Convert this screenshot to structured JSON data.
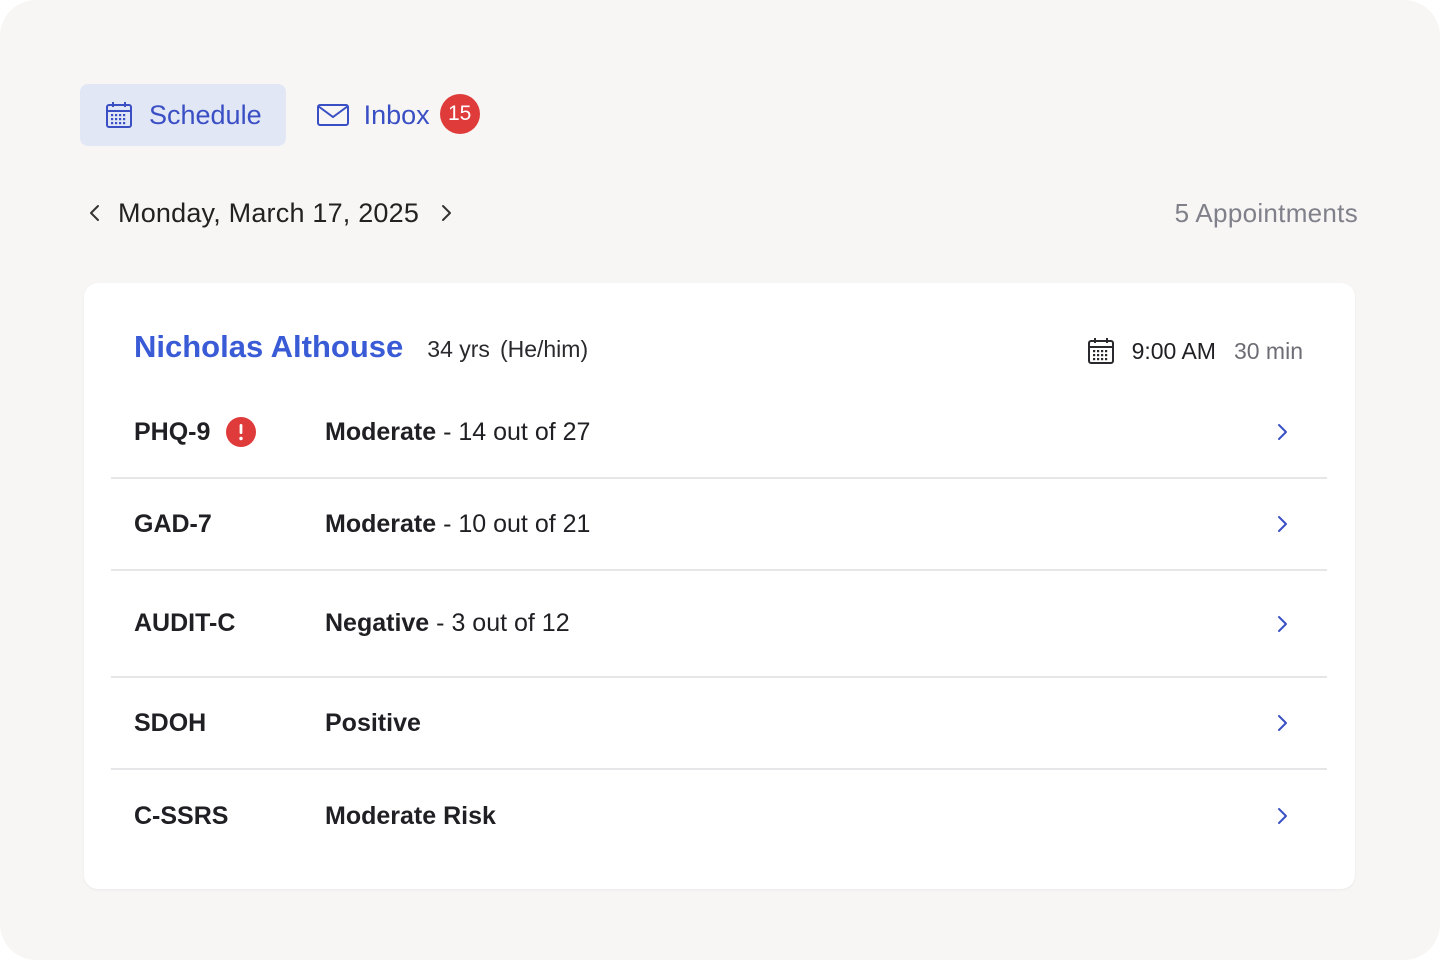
{
  "tabs": {
    "schedule_label": "Schedule",
    "inbox_label": "Inbox",
    "inbox_badge": "15"
  },
  "date_nav": {
    "date": "Monday, March 17, 2025",
    "appointment_count": "5 Appointments"
  },
  "appointment": {
    "patient_name": "Nicholas Althouse",
    "age": "34 yrs",
    "pronouns": "(He/him)",
    "time": "9:00 AM",
    "duration": "30 min"
  },
  "screenings": [
    {
      "measure": "PHQ-9",
      "level": "Moderate",
      "detail": "- 14 out of 27",
      "alert": true
    },
    {
      "measure": "GAD-7",
      "level": "Moderate",
      "detail": "- 10 out of 21",
      "alert": false
    },
    {
      "measure": "AUDIT-C",
      "level": "Negative",
      "detail": "- 3 out of 12",
      "alert": false
    },
    {
      "measure": "SDOH",
      "level": "Positive",
      "detail": "",
      "alert": false
    },
    {
      "measure": "C-SSRS",
      "level": "Moderate Risk",
      "detail": "",
      "alert": false
    }
  ],
  "colors": {
    "accent": "#3a5bd6",
    "tab_active_bg": "#e2e7f6",
    "badge": "#e03b3b",
    "alert": "#e03b3b"
  },
  "icons": {
    "schedule_tab": "calendar-icon",
    "inbox_tab": "mail-icon",
    "prev_day": "chevron-left-icon",
    "next_day": "chevron-right-icon",
    "appointment_time": "calendar-icon",
    "row_open": "chevron-right-icon",
    "row_alert": "alert-icon"
  }
}
